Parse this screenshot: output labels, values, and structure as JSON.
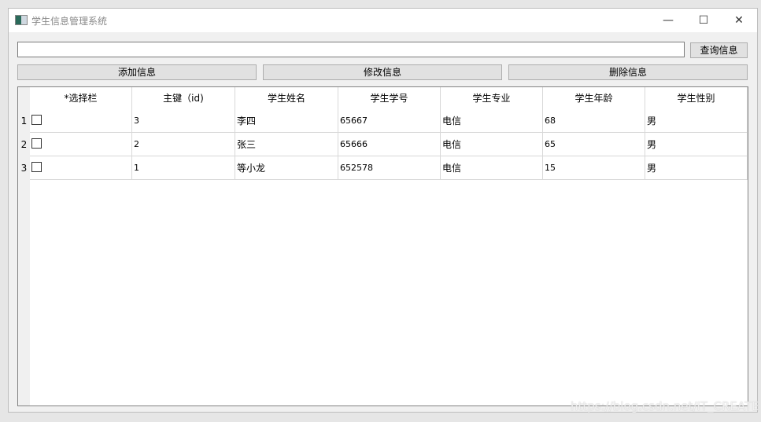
{
  "window": {
    "title": "学生信息管理系统",
    "minimize": "—",
    "maximize": "☐",
    "close": "✕"
  },
  "search": {
    "value": "",
    "query_button": "查询信息"
  },
  "actions": {
    "add": "添加信息",
    "edit": "修改信息",
    "delete": "删除信息"
  },
  "table": {
    "headers": [
      "*选择栏",
      "主键（id)",
      "学生姓名",
      "学生学号",
      "学生专业",
      "学生年龄",
      "学生性别"
    ],
    "rows": [
      {
        "num": "1",
        "checked": false,
        "id": "3",
        "name": "李四",
        "sno": "65667",
        "major": "电信",
        "age": "68",
        "sex": "男"
      },
      {
        "num": "2",
        "checked": false,
        "id": "2",
        "name": "张三",
        "sno": "65666",
        "major": "电信",
        "age": "65",
        "sex": "男"
      },
      {
        "num": "3",
        "checked": false,
        "id": "1",
        "name": "等小龙",
        "sno": "652578",
        "major": "电信",
        "age": "15",
        "sex": "男"
      }
    ]
  },
  "watermark": "https://blog.csdn.net/IT_CREATE"
}
